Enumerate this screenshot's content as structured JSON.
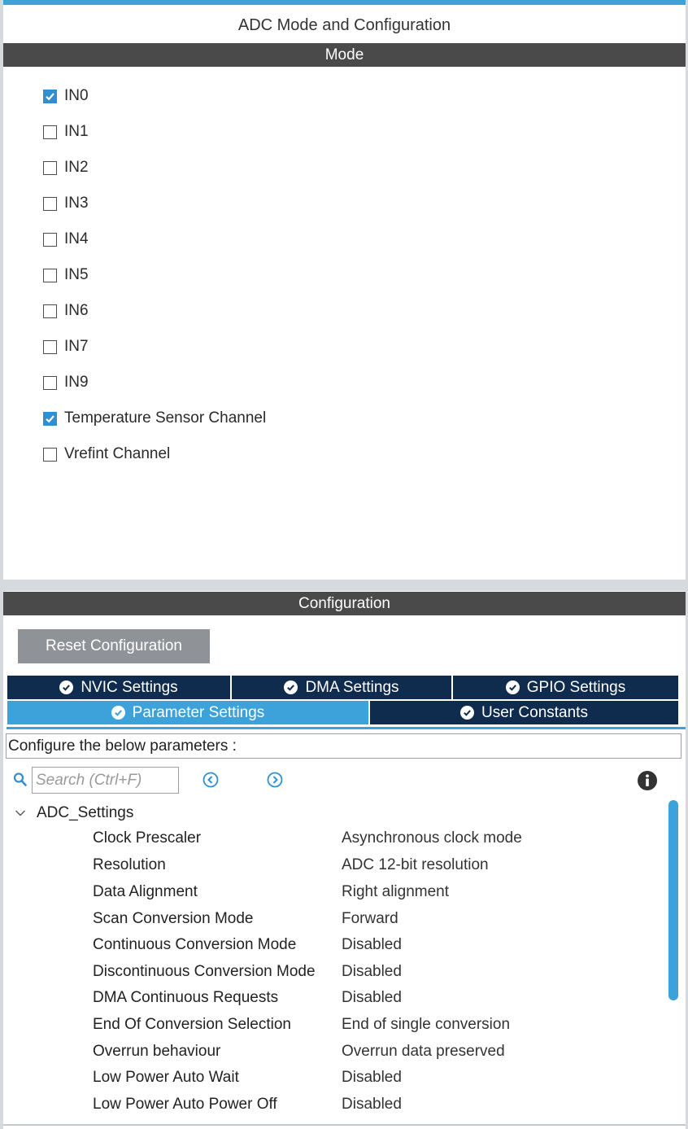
{
  "window": {
    "title": "ADC Mode and Configuration"
  },
  "mode": {
    "header": "Mode",
    "items": [
      {
        "label": "IN0",
        "checked": true
      },
      {
        "label": "IN1",
        "checked": false
      },
      {
        "label": "IN2",
        "checked": false
      },
      {
        "label": "IN3",
        "checked": false
      },
      {
        "label": "IN4",
        "checked": false
      },
      {
        "label": "IN5",
        "checked": false
      },
      {
        "label": "IN6",
        "checked": false
      },
      {
        "label": "IN7",
        "checked": false
      },
      {
        "label": "IN9",
        "checked": false
      },
      {
        "label": "Temperature Sensor Channel",
        "checked": true
      },
      {
        "label": "Vrefint Channel",
        "checked": false
      }
    ]
  },
  "configuration": {
    "header": "Configuration",
    "reset_label": "Reset Configuration",
    "tabs_row1": [
      {
        "label": "NVIC Settings",
        "icon": "check-circle-icon"
      },
      {
        "label": "DMA Settings",
        "icon": "check-circle-icon"
      },
      {
        "label": "GPIO Settings",
        "icon": "check-circle-icon"
      }
    ],
    "tabs_row2": [
      {
        "label": "Parameter Settings",
        "icon": "check-circle-icon",
        "active": true
      },
      {
        "label": "User Constants",
        "icon": "check-circle-icon",
        "active": false
      }
    ],
    "configure_text": "Configure the below parameters :",
    "search_placeholder": "Search (Ctrl+F)",
    "group": "ADC_Settings",
    "params": [
      {
        "name": "Clock Prescaler",
        "value": "Asynchronous clock mode"
      },
      {
        "name": "Resolution",
        "value": "ADC 12-bit resolution"
      },
      {
        "name": "Data Alignment",
        "value": "Right alignment"
      },
      {
        "name": "Scan Conversion Mode",
        "value": "Forward"
      },
      {
        "name": "Continuous Conversion Mode",
        "value": "Disabled"
      },
      {
        "name": "Discontinuous Conversion Mode",
        "value": "Disabled"
      },
      {
        "name": "DMA Continuous Requests",
        "value": "Disabled"
      },
      {
        "name": "End Of Conversion Selection",
        "value": "End of single conversion"
      },
      {
        "name": "Overrun behaviour",
        "value": "Overrun data preserved"
      },
      {
        "name": "Low Power Auto Wait",
        "value": "Disabled"
      },
      {
        "name": "Low Power Auto Power Off",
        "value": "Disabled"
      }
    ]
  },
  "colors": {
    "accent": "#3ca2d9",
    "section_bar": "#4a4a4a",
    "tab_dark": "#0f2b4e",
    "checkbox_checked": "#2f8fd0",
    "reset_button": "#8f9398"
  }
}
